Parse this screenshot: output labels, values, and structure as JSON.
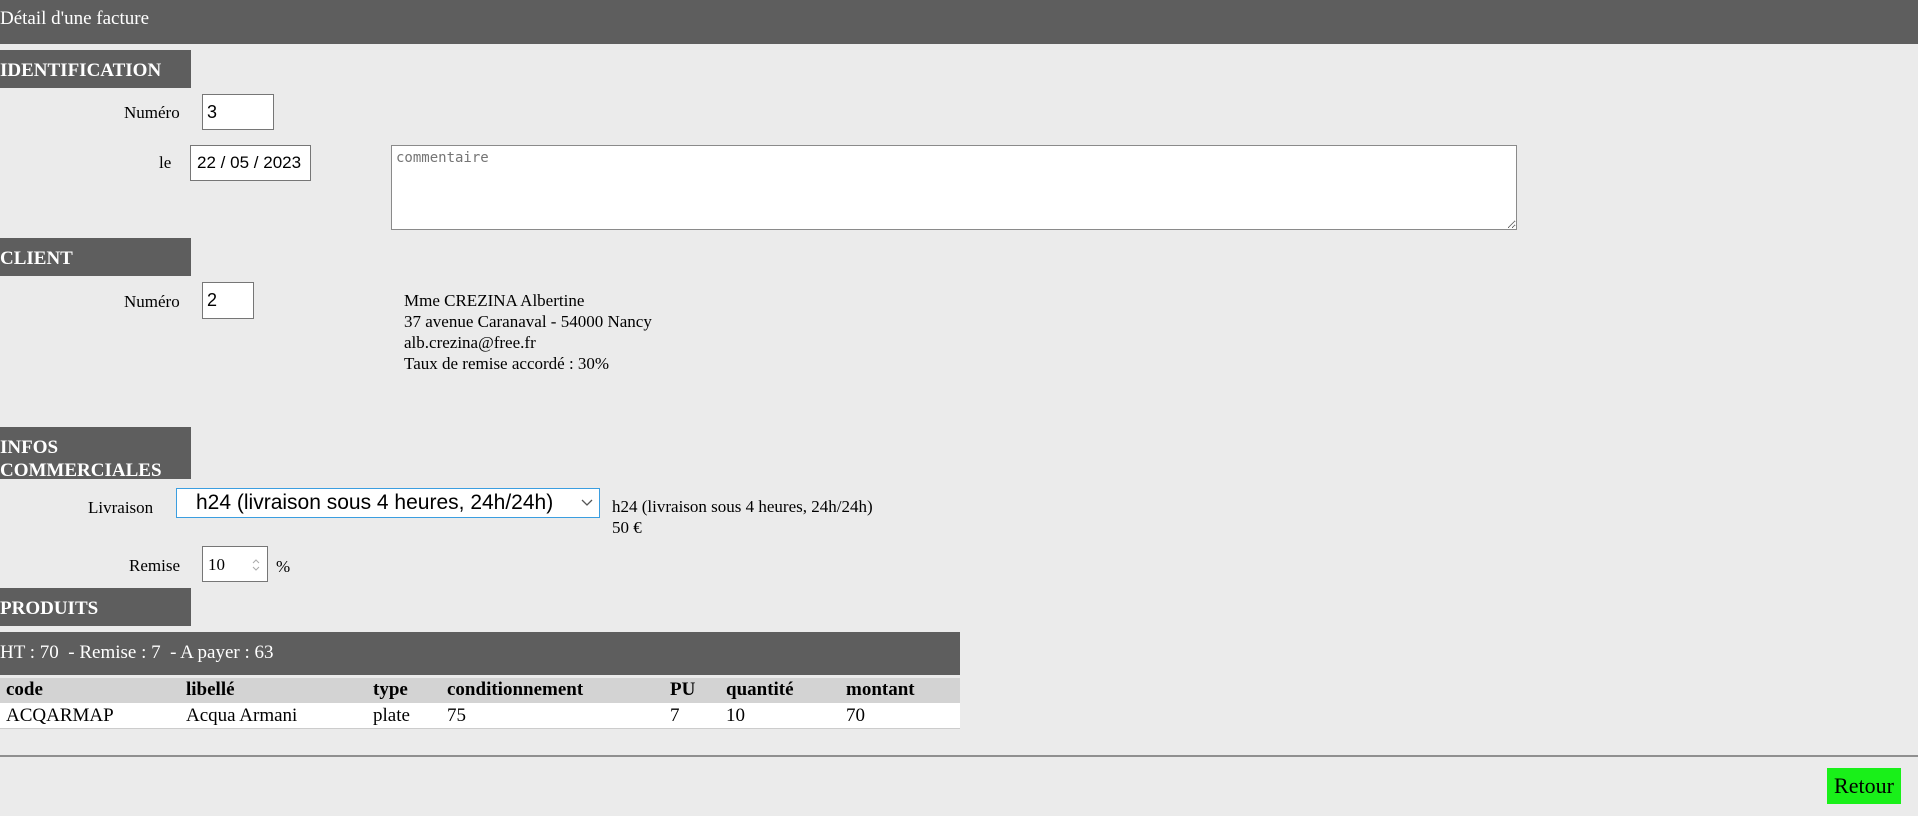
{
  "header": {
    "title": "Détail d'une facture"
  },
  "identification": {
    "section_title": "IDENTIFICATION",
    "numero_label": "Numéro",
    "numero_value": "3",
    "date_label": "le",
    "date_day": "22",
    "date_month": "05",
    "date_year": "2023",
    "date_sep": "/",
    "commentaire_placeholder": "commentaire"
  },
  "client": {
    "section_title": "CLIENT",
    "numero_label": "Numéro",
    "numero_value": "2",
    "name": "Mme CREZINA Albertine",
    "address": "37 avenue Caranaval - 54000 Nancy",
    "email": "alb.crezina@free.fr",
    "discount_rate": "Taux de remise accordé : 30%"
  },
  "infos": {
    "section_title_line1": "INFOS",
    "section_title_line2": "COMMERCIALES",
    "livraison_label": "Livraison",
    "livraison_selected": "h24 (livraison sous 4 heures, 24h/24h)",
    "livraison_desc": "h24 (livraison sous 4 heures, 24h/24h)",
    "livraison_price": "50 €",
    "remise_label": "Remise",
    "remise_value": "10",
    "remise_unit": "%"
  },
  "produits": {
    "section_title": "PRODUITS",
    "totals": "HT : 70  - Remise : 7  - A payer : 63",
    "columns": [
      "code",
      "libellé",
      "type",
      "conditionnement",
      "PU",
      "quantité",
      "montant"
    ],
    "rows": [
      [
        "ACQARMAP",
        "Acqua Armani",
        "plate",
        "75",
        "7",
        "10",
        "70"
      ]
    ]
  },
  "footer": {
    "retour_label": "Retour"
  },
  "colors": {
    "section_bg": "#5e5e5e",
    "page_bg": "#ebebeb",
    "retour_bg": "#19f019",
    "select_border": "#3b9ee0"
  }
}
